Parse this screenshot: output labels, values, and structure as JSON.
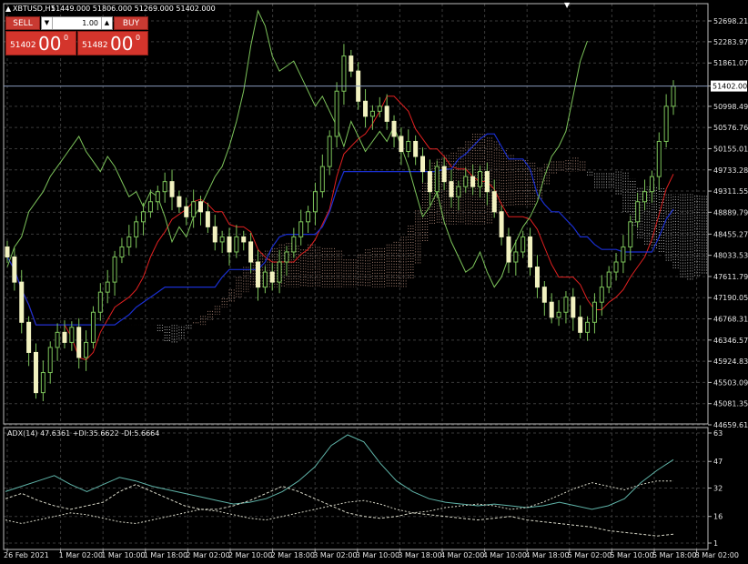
{
  "header": {
    "symbol": "XBTUSD,H1",
    "ohlc": "51449.000 51806.000 51269.000 51402.000"
  },
  "trade_panel": {
    "sell_label": "SELL",
    "buy_label": "BUY",
    "lot": "1.00",
    "sell_small": "51402",
    "sell_big": "00",
    "sell_sup": "0",
    "buy_small": "51482",
    "buy_big": "00",
    "buy_sup": "0"
  },
  "current_price_label": "51402.000",
  "price_ticks": [
    "52698.210",
    "52283.970",
    "51861.070",
    "51402.000",
    "50998.490",
    "50576.760",
    "50155.010",
    "49733.280",
    "49311.550",
    "48889.790",
    "48455.270",
    "48033.530",
    "47611.790",
    "47190.050",
    "46768.310",
    "46346.570",
    "45924.830",
    "45503.090",
    "45081.350",
    "44659.610"
  ],
  "adx_ticks": [
    "63",
    "47",
    "32",
    "16",
    "1"
  ],
  "adx_header": "ADX(14) 47.6361 +DI:35.6622 -DI:5.6664",
  "time_ticks": [
    "26 Feb 2021",
    "1 Mar 02:00",
    "1 Mar 10:00",
    "1 Mar 18:00",
    "2 Mar 02:00",
    "2 Mar 10:00",
    "2 Mar 18:00",
    "3 Mar 02:00",
    "3 Mar 10:00",
    "3 Mar 18:00",
    "4 Mar 02:00",
    "4 Mar 10:00",
    "4 Mar 18:00",
    "5 Mar 02:00",
    "5 Mar 10:00",
    "5 Mar 18:00",
    "8 Mar 02:00"
  ],
  "chart_data": [
    {
      "type": "candlestick",
      "title": "XBTUSD,H1",
      "ylim": [
        44659.61,
        52698.21
      ],
      "current_price": 51402.0,
      "series": [
        {
          "name": "XBTUSD,H1",
          "description": "hourly candles, approximate closes",
          "close": [
            48000,
            47500,
            46700,
            46100,
            45300,
            45700,
            46200,
            46500,
            46300,
            46600,
            46000,
            46300,
            46900,
            47300,
            47500,
            48000,
            48200,
            48400,
            48700,
            48900,
            49100,
            49300,
            49500,
            49200,
            49000,
            48800,
            49100,
            48900,
            48600,
            48300,
            48400,
            48100,
            48400,
            48300,
            47900,
            47400,
            47700,
            47500,
            47900,
            48100,
            48400,
            48700,
            48900,
            49300,
            49800,
            50400,
            51300,
            52000,
            51700,
            51100,
            50800,
            50900,
            51000,
            50700,
            50400,
            50100,
            50300,
            50000,
            49700,
            49300,
            49800,
            49500,
            49200,
            49400,
            49600,
            49400,
            49700,
            49300,
            48900,
            48400,
            47900,
            48100,
            48400,
            47800,
            47400,
            47100,
            46800,
            46900,
            47200,
            46800,
            46500,
            46700,
            47100,
            47400,
            47700,
            47900,
            48200,
            48700,
            49100,
            49300,
            49600,
            50300,
            51000,
            51400
          ]
        }
      ],
      "overlays": [
        "Ichimoku cloud (dotted)",
        "Ichimoku tenkan-sen (red)",
        "Ichimoku kijun-sen (blue)",
        "Ichimoku chikou span (green)",
        "current price line 51402.000"
      ]
    },
    {
      "type": "line",
      "title": "ADX(14) 47.6361 +DI:35.6622 -DI:5.6664",
      "ylim": [
        1,
        63
      ],
      "series": [
        {
          "name": "ADX",
          "values": [
            30,
            33,
            36,
            39,
            34,
            30,
            34,
            38,
            36,
            33,
            31,
            29,
            27,
            25,
            23,
            24,
            26,
            30,
            36,
            44,
            56,
            62,
            58,
            46,
            36,
            30,
            26,
            24,
            23,
            22,
            23,
            22,
            21,
            22,
            24,
            22,
            20,
            22,
            26,
            35,
            42,
            48
          ]
        },
        {
          "name": "+DI",
          "values": [
            26,
            29,
            25,
            22,
            20,
            22,
            24,
            30,
            34,
            30,
            26,
            22,
            20,
            20,
            22,
            25,
            29,
            33,
            30,
            26,
            22,
            18,
            16,
            15,
            16,
            18,
            17,
            16,
            15,
            14,
            15,
            16,
            14,
            13,
            12,
            11,
            10,
            8,
            7,
            6,
            5,
            6
          ]
        },
        {
          "name": "-DI",
          "values": [
            14,
            12,
            14,
            16,
            18,
            17,
            15,
            13,
            12,
            14,
            16,
            18,
            20,
            19,
            17,
            15,
            14,
            16,
            18,
            20,
            22,
            24,
            25,
            23,
            20,
            18,
            19,
            21,
            22,
            23,
            22,
            20,
            21,
            24,
            28,
            32,
            35,
            33,
            31,
            34,
            36,
            36
          ]
        }
      ]
    }
  ]
}
